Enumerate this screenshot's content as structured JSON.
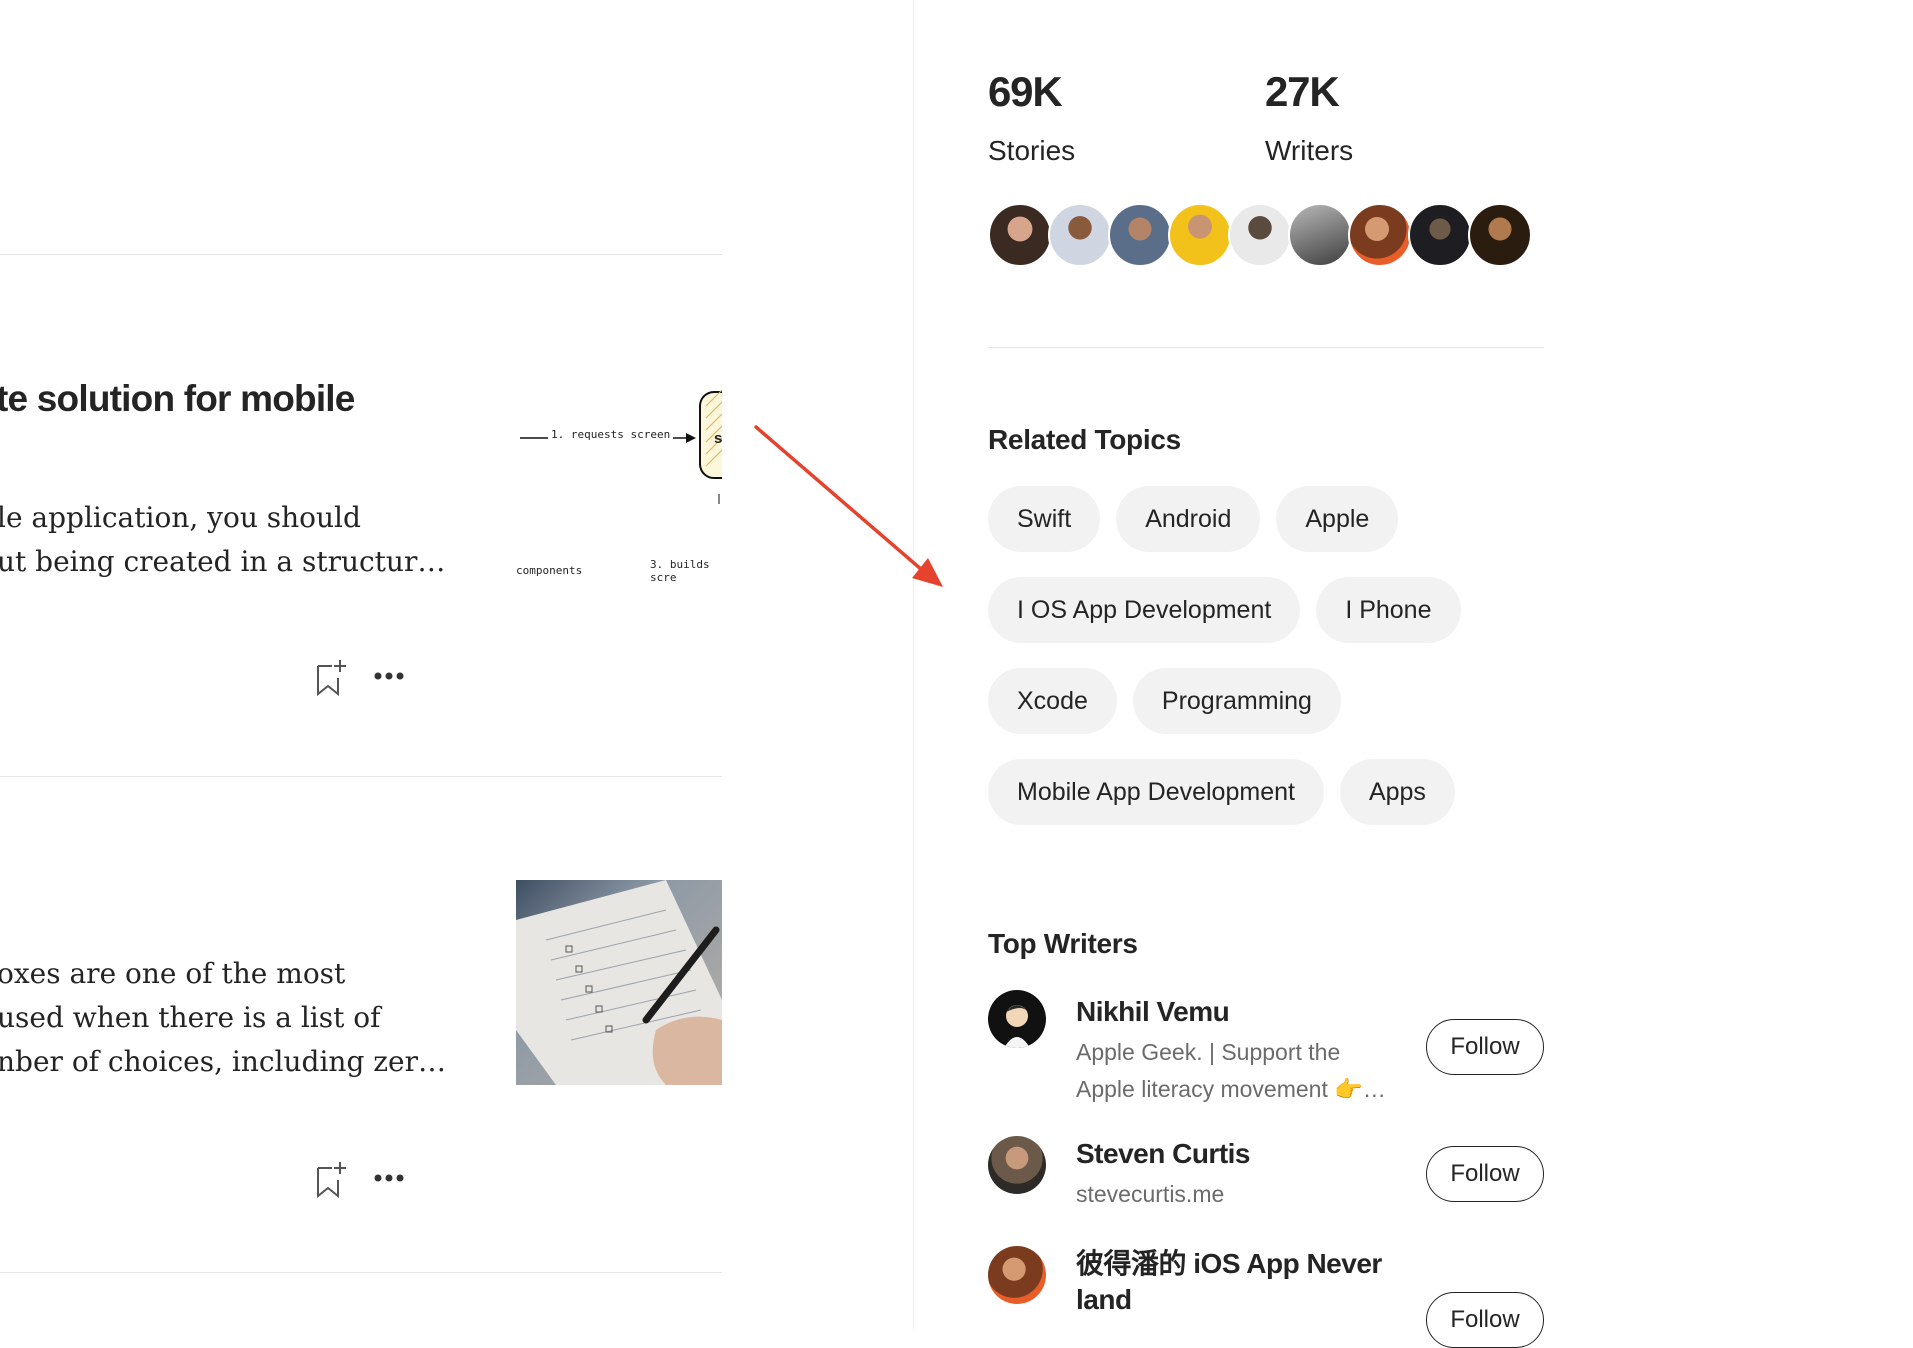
{
  "feed": {
    "articles": [
      {
        "title": "te solution for mobile",
        "excerpt_lines": [
          "le application, you should",
          "ut being created in a structur…"
        ],
        "thumbnail_labels": [
          "1. requests screen",
          "components",
          "3. builds scre",
          "s"
        ]
      },
      {
        "excerpt_lines": [
          "oxes are one of the most",
          "used when there is a list of",
          "nber of choices, including zer…"
        ]
      }
    ]
  },
  "stats": [
    {
      "value": "69K",
      "label": "Stories"
    },
    {
      "value": "27K",
      "label": "Writers"
    }
  ],
  "related_topics": {
    "title": "Related Topics",
    "rows": [
      [
        "Swift",
        "Android",
        "Apple"
      ],
      [
        "I OS App Development",
        "I Phone"
      ],
      [
        "Xcode",
        "Programming"
      ],
      [
        "Mobile App Development",
        "Apps"
      ]
    ]
  },
  "top_writers": {
    "title": "Top Writers",
    "follow_label": "Follow",
    "writers": [
      {
        "name": "Nikhil Vemu",
        "bio_lines": [
          "Apple Geek. | Support the",
          "Apple literacy movement 👉…"
        ]
      },
      {
        "name": "Steven Curtis",
        "bio_lines": [
          "stevecurtis.me"
        ]
      },
      {
        "name_lines": [
          "彼得潘的 iOS App Never",
          "land"
        ]
      }
    ]
  },
  "colors": {
    "arrow": "#e5432d",
    "chip_bg": "#f2f2f2",
    "muted_text": "#6b6b6b"
  }
}
